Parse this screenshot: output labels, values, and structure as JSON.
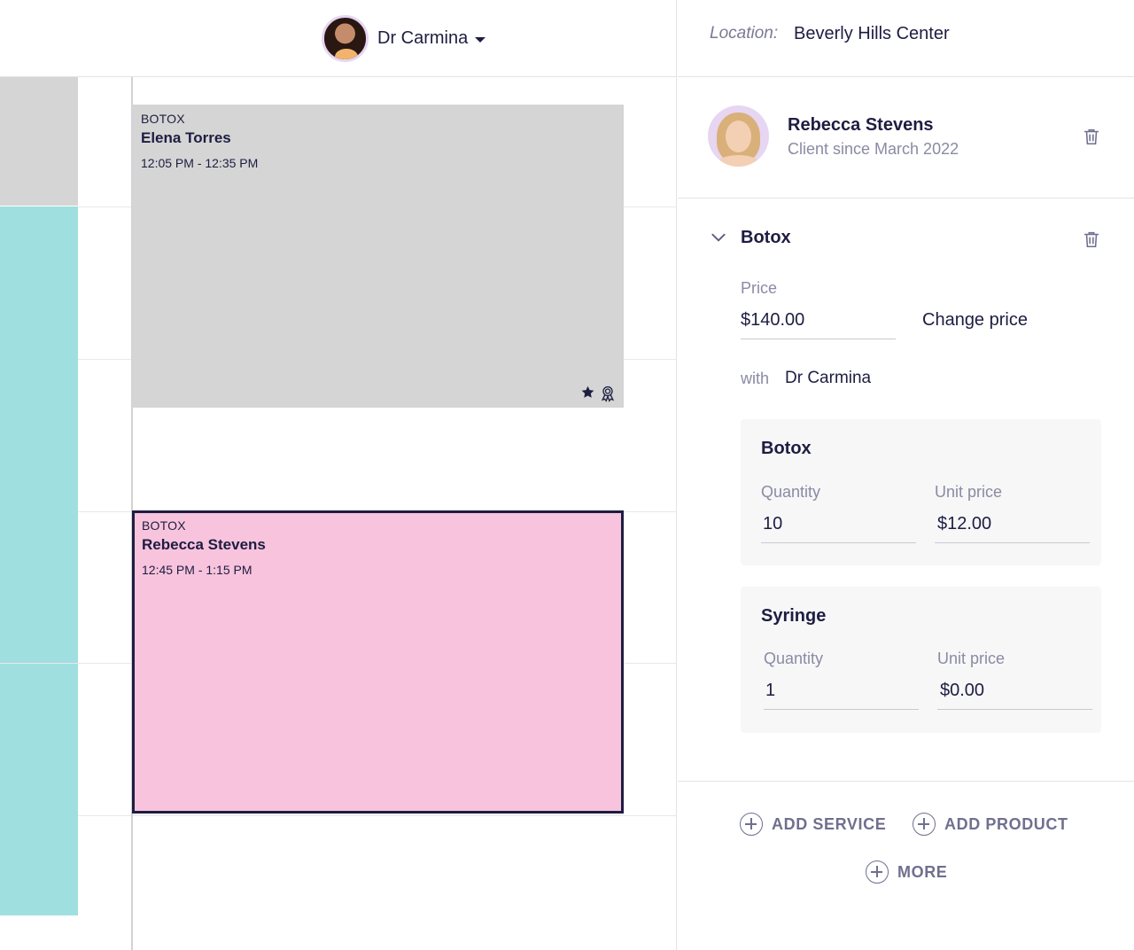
{
  "calendar": {
    "staff_name": "Dr Carmina",
    "appointments": [
      {
        "type": "BOTOX",
        "client": "Elena Torres",
        "time": "12:05 PM - 12:35 PM",
        "color": "#d5d5d5"
      },
      {
        "type": "BOTOX",
        "client": "Rebecca Stevens",
        "time": "12:45 PM - 1:15 PM",
        "color": "#f8c3dc"
      }
    ],
    "appointment_icons": [
      "star-icon",
      "award-ribbon-icon"
    ]
  },
  "panel": {
    "location_label": "Location:",
    "location_value": "Beverly Hills Center",
    "client": {
      "name": "Rebecca Stevens",
      "since": "Client since March 2022"
    },
    "service": {
      "title": "Botox",
      "price_label": "Price",
      "price_value": "$140.00",
      "change_price": "Change price",
      "with_label": "with",
      "with_value": "Dr Carmina",
      "products": [
        {
          "name": "Botox",
          "quantity_label": "Quantity",
          "quantity": "10",
          "unit_price_label": "Unit price",
          "unit_price": "$12.00"
        },
        {
          "name": "Syringe",
          "quantity_label": "Quantity",
          "quantity": "1",
          "unit_price_label": "Unit price",
          "unit_price": "$0.00"
        }
      ]
    },
    "actions": {
      "add_service": "ADD SERVICE",
      "add_product": "ADD PRODUCT",
      "more": "MORE"
    }
  },
  "colors": {
    "navy": "#1d1d42",
    "teal_strip": "#a0dfdf",
    "gray_block": "#d5d5d5",
    "pink_block": "#f8c3dc",
    "muted": "#8a8aa5"
  }
}
